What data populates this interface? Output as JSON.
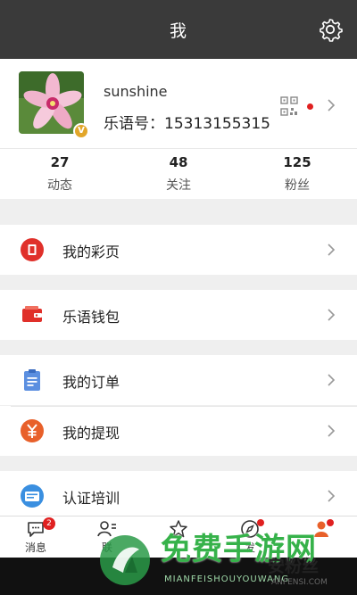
{
  "header": {
    "title": "我",
    "settings_icon": "gear-icon"
  },
  "profile": {
    "username": "sunshine",
    "id_line": "乐语号：15313155315",
    "badge": "V",
    "qr_icon": "qr-code-icon"
  },
  "stats": [
    {
      "count": "27",
      "label": "动态"
    },
    {
      "count": "48",
      "label": "关注"
    },
    {
      "count": "125",
      "label": "粉丝"
    }
  ],
  "menu": [
    {
      "label": "我的彩页",
      "icon": "color-page-icon",
      "color": "#e0302a"
    },
    {
      "label": "乐语钱包",
      "icon": "wallet-icon",
      "color": "#e0302a"
    },
    {
      "label": "我的订单",
      "icon": "clipboard-icon",
      "color": "#5b8fe0"
    },
    {
      "label": "我的提现",
      "icon": "yen-coin-icon",
      "color": "#e8602a"
    },
    {
      "label": "认证培训",
      "icon": "certificate-icon",
      "color": "#3a8fe0"
    }
  ],
  "tabbar": {
    "messages_label": "消息",
    "messages_badge": "2",
    "contacts_label": "联",
    "discover_label": "发",
    "tabs": [
      "message-icon",
      "contacts-icon",
      "star-icon",
      "compass-icon",
      "me-icon"
    ]
  },
  "watermark": {
    "title": "免费手游网",
    "subtitle": "MIANFEISHOUYOUWANG",
    "brand": "安粉丝",
    "brand_sub": "ANFENSI.COM"
  },
  "colors": {
    "topbar": "#3a3a3a",
    "accent_red": "#e02020",
    "badge_gold": "#e2a62a"
  }
}
